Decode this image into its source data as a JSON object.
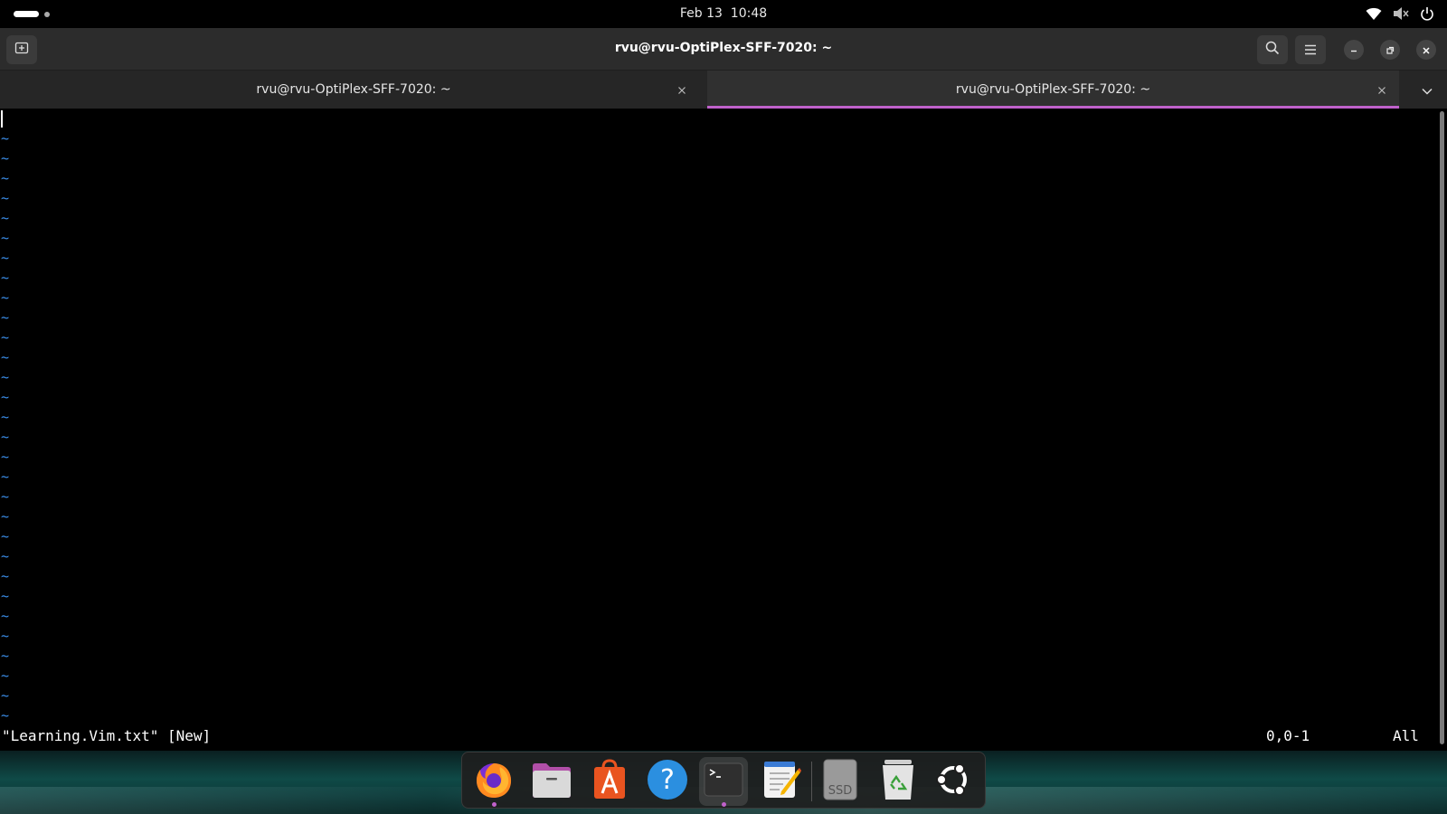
{
  "topbar": {
    "date": "Feb 13",
    "time": "10:48",
    "icons": [
      "wifi-icon",
      "volume-muted-icon",
      "power-icon"
    ]
  },
  "window": {
    "title": "rvu@rvu-OptiPlex-SFF-7020: ~",
    "buttons": [
      "new-tab-icon",
      "search-icon",
      "menu-icon",
      "minimize-icon",
      "restore-icon",
      "close-icon"
    ]
  },
  "tabs": [
    {
      "label": "rvu@rvu-OptiPlex-SFF-7020: ~",
      "active": false
    },
    {
      "label": "rvu@rvu-OptiPlex-SFF-7020: ~",
      "active": true
    }
  ],
  "terminal": {
    "tilde": "~",
    "tilde_count": 30,
    "status_file": "\"Learning.Vim.txt\" [New]",
    "status_position": "0,0-1",
    "status_scroll": "All",
    "tilde_color": "#3b8eea"
  },
  "dock": {
    "apps": [
      {
        "name": "Firefox",
        "icon": "firefox-icon",
        "running": true
      },
      {
        "name": "Files",
        "icon": "files-icon",
        "running": false
      },
      {
        "name": "App Center",
        "icon": "app-center-icon",
        "running": false
      },
      {
        "name": "Help",
        "icon": "help-icon",
        "running": false
      },
      {
        "name": "Terminal",
        "icon": "terminal-icon",
        "running": true,
        "active": true
      },
      {
        "name": "Text Editor",
        "icon": "text-editor-icon",
        "running": false
      },
      {
        "name": "SSD",
        "icon": "ssd-drive-icon",
        "label": "SSD",
        "running": false
      },
      {
        "name": "Trash",
        "icon": "trash-icon",
        "running": false
      },
      {
        "name": "Show Apps",
        "icon": "ubuntu-apps-icon",
        "running": false
      }
    ]
  },
  "colors": {
    "accent": "#c061cb",
    "header_bg": "#2c2c2c",
    "terminal_bg": "#000000"
  }
}
